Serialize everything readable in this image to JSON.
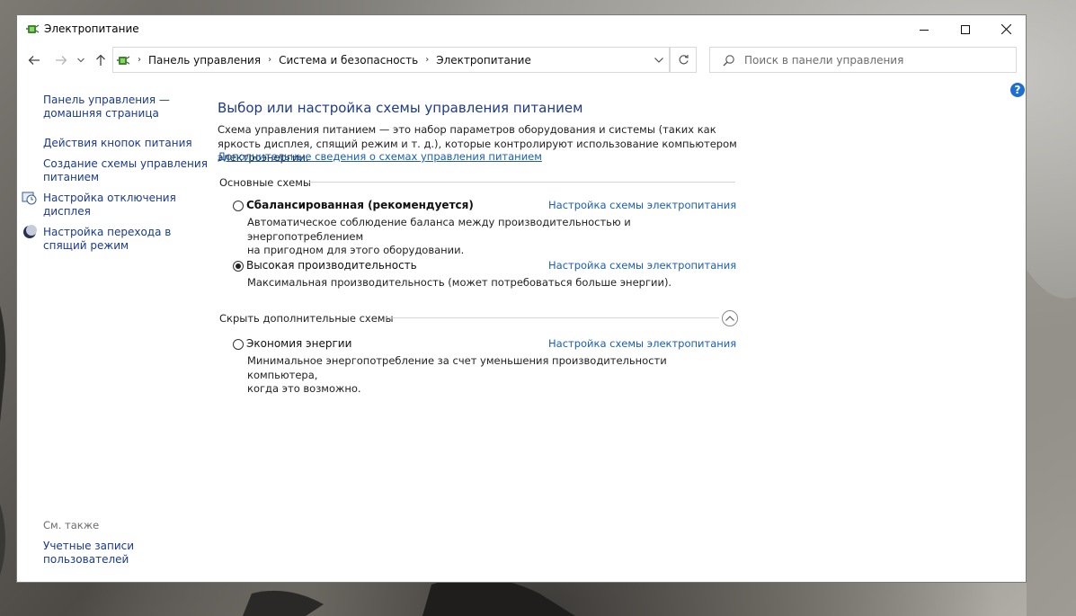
{
  "window": {
    "title": "Электропитание"
  },
  "address_bar": {
    "crumbs": [
      "Панель управления",
      "Система и безопасность",
      "Электропитание"
    ]
  },
  "search": {
    "placeholder": "Поиск в панели управления"
  },
  "left_pane": {
    "home_line1": "Панель управления —",
    "home_line2": "домашняя страница",
    "power_buttons": "Действия кнопок питания",
    "create_plan_line1": "Создание схемы управления",
    "create_plan_line2": "питанием",
    "display_off_line1": "Настройка отключения",
    "display_off_line2": "дисплея",
    "sleep_line1": "Настройка перехода в",
    "sleep_line2": "спящий режим",
    "see_also": "См. также",
    "user_accounts_line1": "Учетные записи",
    "user_accounts_line2": "пользователей"
  },
  "main": {
    "heading": "Выбор или настройка схемы управления питанием",
    "description": "Схема управления питанием — это набор параметров оборудования и системы (таких как яркость дисплея, спящий режим и т. д.), которые контролируют использование компьютером электроэнергии.",
    "more_info_link": "Дополнительные сведения о схемах управления питанием",
    "basic_section": "Основные схемы",
    "hide_section": "Скрыть дополнительные схемы",
    "plan_settings_link": "Настройка схемы электропитания",
    "plans": [
      {
        "name": "Сбалансированная (рекомендуется)",
        "selected": false,
        "desc_line1": "Автоматическое соблюдение баланса между производительностью и энергопотреблением",
        "desc_line2": "на пригодном для этого оборудовании."
      },
      {
        "name": "Высокая производительность",
        "selected": true,
        "desc_line1": "Максимальная производительность (может потребоваться больше энергии)."
      },
      {
        "name": "Экономия энергии",
        "selected": false,
        "desc_line1": "Минимальное энергопотребление за счет уменьшения производительности компьютера,",
        "desc_line2": "когда это возможно."
      }
    ]
  },
  "icons": {
    "app": "power-options-icon",
    "back": "back-arrow-icon",
    "forward": "forward-arrow-icon",
    "recent": "chevron-down-icon",
    "up": "up-arrow-icon",
    "refresh": "refresh-icon",
    "search": "search-icon",
    "help": "help-icon"
  },
  "colors": {
    "link": "#1a5fb4",
    "nav_link": "#1a3a8c",
    "heading": "#1e3a8a",
    "help": "#1e6fd0"
  }
}
